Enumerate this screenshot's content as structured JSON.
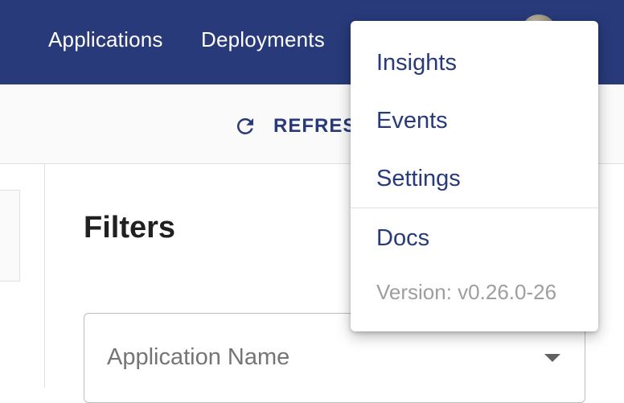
{
  "appbar": {
    "nav": [
      "Applications",
      "Deployments"
    ],
    "background_color": "#283a7a"
  },
  "toolbar": {
    "refresh_label": "REFRES",
    "refresh_icon": "refresh-icon"
  },
  "filters": {
    "title": "Filters",
    "application_name_label": "Application Name",
    "dropdown_icon": "arrow-drop-down-icon"
  },
  "menu": {
    "items": [
      "Insights",
      "Events",
      "Settings"
    ],
    "docs_label": "Docs",
    "version": "Version: v0.26.0-26"
  },
  "colors": {
    "accent": "#283a7a",
    "muted_text": "#9e9e9e"
  }
}
